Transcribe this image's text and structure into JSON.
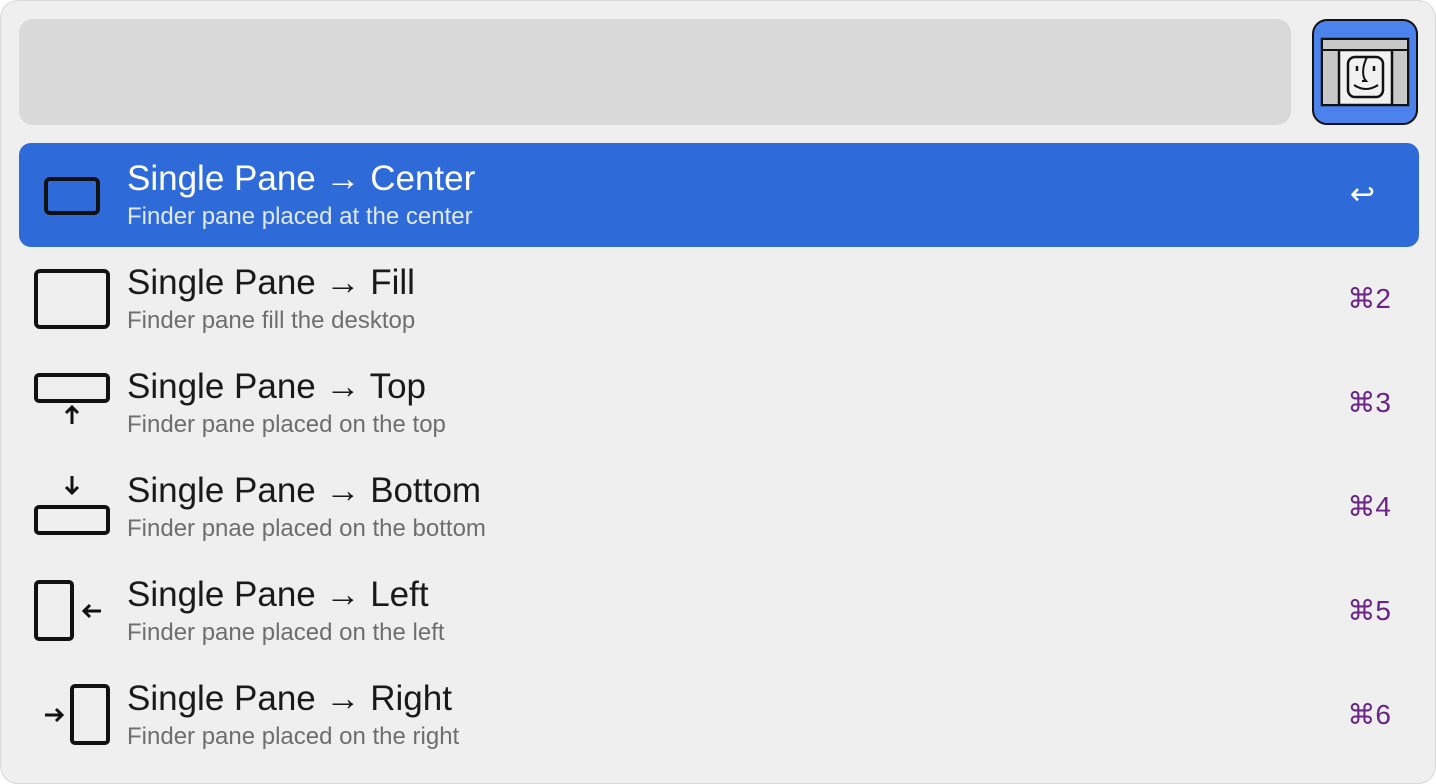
{
  "search": {
    "query": "",
    "placeholder": ""
  },
  "app_icon": {
    "name": "finder-panes-icon"
  },
  "colors": {
    "window_bg": "#efefef",
    "search_bg": "#d9d9d9",
    "selection": "#2f6bd8",
    "shortcut": "#6a2387",
    "app_icon_bg": "#4c82eb"
  },
  "results": [
    {
      "title": "Single Pane → Center",
      "subtitle": "Finder pane placed at the center",
      "shortcut": "↩",
      "icon": "pane-center-icon",
      "selected": true
    },
    {
      "title": "Single Pane → Fill",
      "subtitle": "Finder pane fill the desktop",
      "shortcut": "⌘2",
      "icon": "pane-fill-icon",
      "selected": false
    },
    {
      "title": "Single Pane → Top",
      "subtitle": "Finder pane placed on the top",
      "shortcut": "⌘3",
      "icon": "pane-top-icon",
      "selected": false
    },
    {
      "title": "Single Pane → Bottom",
      "subtitle": "Finder pnae placed on the bottom",
      "shortcut": "⌘4",
      "icon": "pane-bottom-icon",
      "selected": false
    },
    {
      "title": "Single Pane → Left",
      "subtitle": "Finder pane placed on the left",
      "shortcut": "⌘5",
      "icon": "pane-left-icon",
      "selected": false
    },
    {
      "title": "Single Pane → Right",
      "subtitle": "Finder pane placed on the right",
      "shortcut": "⌘6",
      "icon": "pane-right-icon",
      "selected": false
    }
  ]
}
